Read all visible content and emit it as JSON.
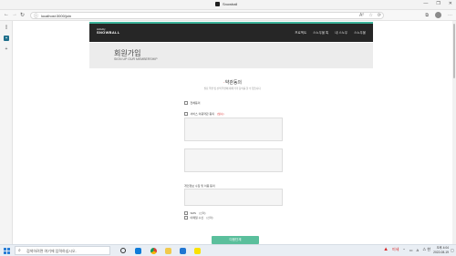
{
  "browser": {
    "title": "Snowball",
    "url": "localhost:3000/join",
    "win_controls": [
      "—",
      "❐",
      "✕"
    ],
    "toolbar_icons": [
      "A⁰",
      "☆",
      "⟳",
      "⧉",
      "⋯"
    ]
  },
  "site": {
    "logo_line1": "Activity",
    "logo_line2": "SNOWBALL",
    "menu": [
      "프로젝트",
      "스노우볼 톡",
      "내 스노우",
      "스노우볼"
    ]
  },
  "banner": {
    "title": "회원가입",
    "subtitle": "SIGN UP OUR MEMBERSHIP"
  },
  "terms": {
    "mark": "·",
    "title": "약관동의",
    "desc": "필요 약관 및 선택 약관에 대해 각각 동의를 할 수 있습니다.",
    "agree_all": "전체동의",
    "service_label": "서비스 이용약관 동의",
    "service_req": "(필수)",
    "privacy_label": "개인정보 수집 및 이용 동의",
    "sms_label": "SMS",
    "sms_opt": "(선택)",
    "email_label": "이메일 수신",
    "email_opt": "(선택)",
    "submit": "다음단계"
  },
  "taskbar": {
    "search_placeholder": "검색하려면 여기에 입력하십시오.",
    "weather": "미세",
    "ime": "A",
    "lang": "⁂ 한",
    "time": "오후 4:04",
    "date": "2022-08-19"
  },
  "colors": {
    "accent": "#3cb39a",
    "header_bg": "#262626",
    "submit_bg": "#5abf9c",
    "required": "#d33333"
  }
}
